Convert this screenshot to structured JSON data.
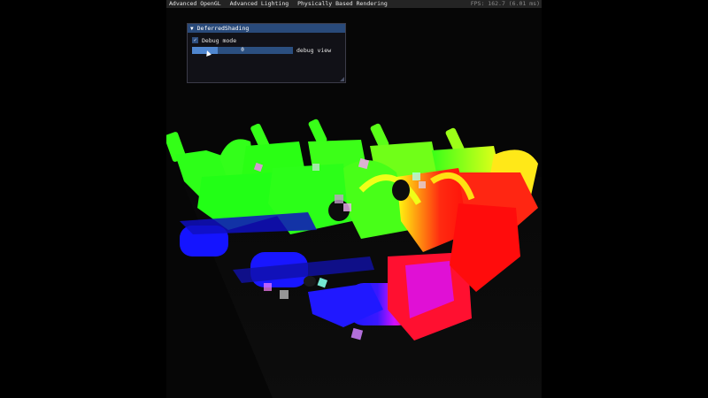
{
  "menu": {
    "items": [
      "Advanced OpenGL",
      "Advanced Lighting",
      "Physically Based Rendering"
    ],
    "fps": "FPS: 162.7 (6.01 ms)"
  },
  "panel": {
    "title": "DeferredShading",
    "checkbox_label": "Debug mode",
    "checked": true,
    "slider_value": "0",
    "slider_label": "debug view"
  },
  "scene": {
    "description_colors": {
      "green": "#2dff1a",
      "yellow": "#e6ff18",
      "red": "#ff1010",
      "blue": "#1818ff",
      "magenta": "#d60cff"
    }
  }
}
